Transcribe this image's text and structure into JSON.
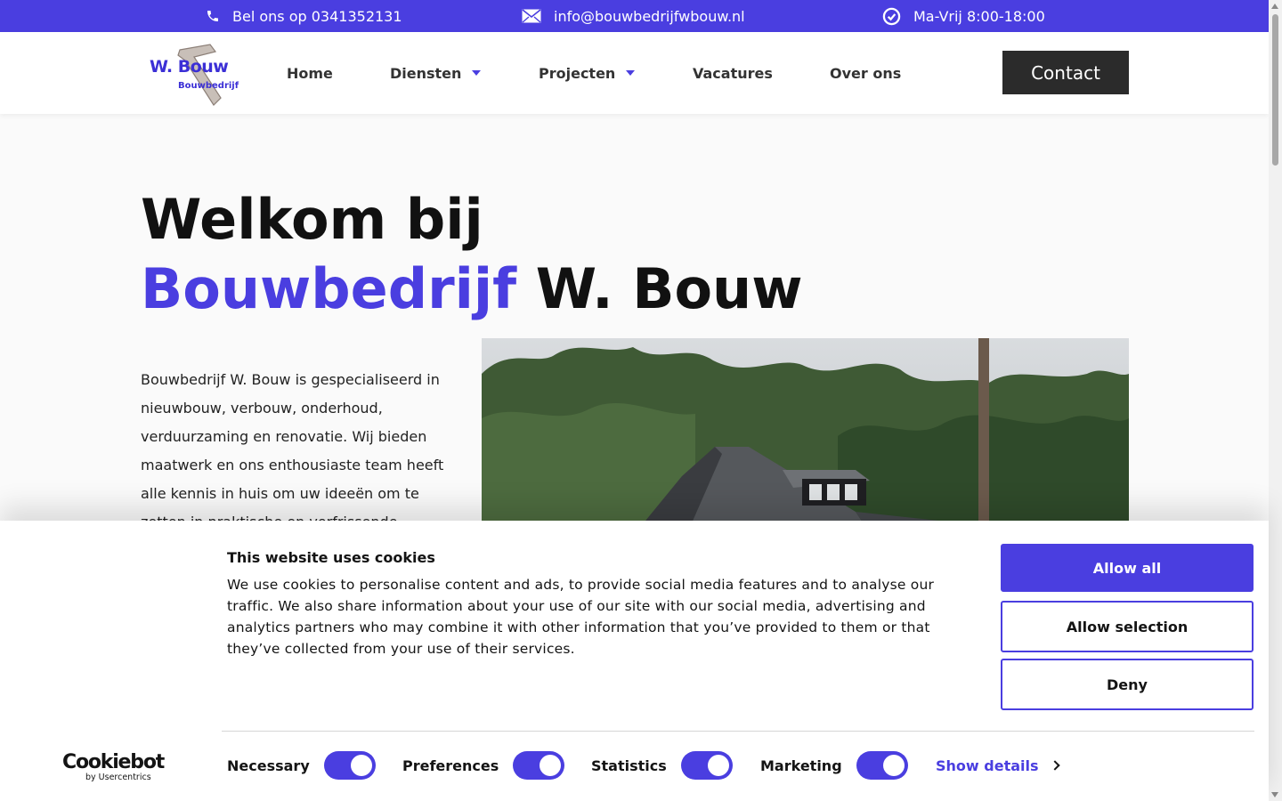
{
  "topbar": {
    "phone": "Bel ons op 0341352131",
    "email": "info@bouwbedrijfwbouw.nl",
    "hours": "Ma-Vrij 8:00-18:00",
    "icons": [
      "phone-icon",
      "envelope-icon",
      "clock-check-icon"
    ]
  },
  "header": {
    "logo": {
      "line1": "W. Bouw",
      "line2": "Bouwbedrijf"
    },
    "nav": [
      {
        "label": "Home"
      },
      {
        "label": "Diensten"
      },
      {
        "label": "Projecten"
      },
      {
        "label": "Vacatures"
      },
      {
        "label": "Over ons"
      }
    ],
    "contact_label": "Contact"
  },
  "hero": {
    "title_line1": "Welkom bij",
    "title_accent": "Bouwbedrijf",
    "title_rest": "W. Bouw",
    "intro": "Bouwbedrijf W. Bouw is gespecialiseerd in nieuwbouw, verbouw, onderhoud, verduurzaming en renovatie. Wij bieden maatwerk en ons enthousiaste team heeft alle kennis in huis om uw ideeën om te zetten in praktische en verfrissende"
  },
  "cookie": {
    "title": "This website uses cookies",
    "text": "We use cookies to personalise content and ads, to provide social media features and to analyse our traffic. We also share information about your use of our site with our social media, advertising and analytics partners who may combine it with other information that you’ve provided to them or that they’ve collected from your use of their services.",
    "allow_all": "Allow all",
    "allow_selection": "Allow selection",
    "deny": "Deny",
    "brand": {
      "name": "Cookiebot",
      "sub": "by Usercentrics"
    },
    "categories": [
      {
        "label": "Necessary",
        "enabled": true
      },
      {
        "label": "Preferences",
        "enabled": true
      },
      {
        "label": "Statistics",
        "enabled": true
      },
      {
        "label": "Marketing",
        "enabled": true
      }
    ],
    "show_details": "Show details"
  },
  "colors": {
    "accent": "#4a3ee0",
    "dark_button": "#2b2b2b"
  }
}
